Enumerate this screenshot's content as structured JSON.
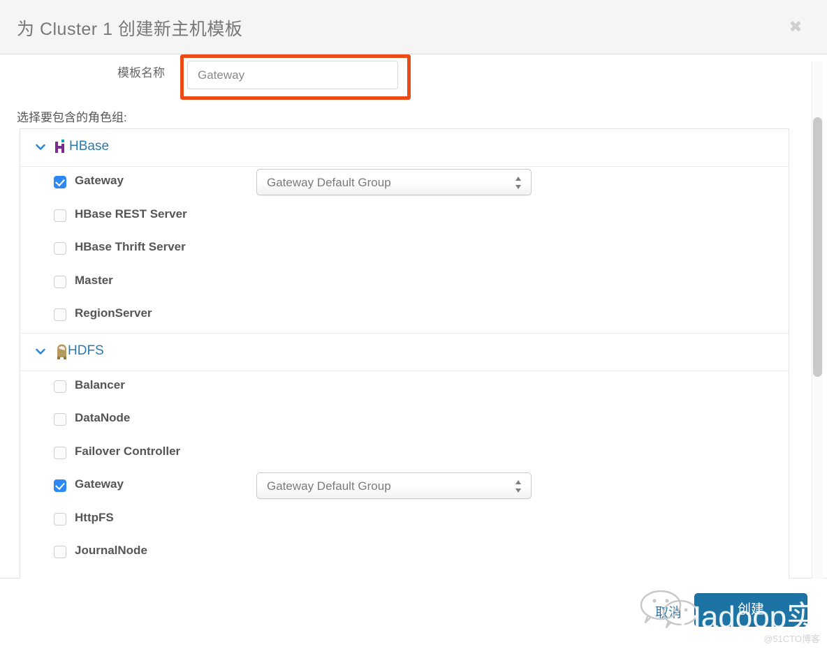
{
  "dialog": {
    "title": "为 Cluster 1 创建新主机模板",
    "close_icon": "close-icon"
  },
  "form": {
    "name_label": "模板名称",
    "name_value": "Gateway",
    "name_placeholder": "Gateway",
    "highlight_color": "#ea4b17"
  },
  "section": {
    "label": "选择要包含的角色组:"
  },
  "services": [
    {
      "name": "HBase",
      "icon": "hbase-logo-icon",
      "expanded": true,
      "chevron_icon": "chevron-down-icon",
      "roles": [
        {
          "label": "Gateway",
          "checked": true,
          "group": "Gateway Default Group"
        },
        {
          "label": "HBase REST Server",
          "checked": false,
          "group": null
        },
        {
          "label": "HBase Thrift Server",
          "checked": false,
          "group": null
        },
        {
          "label": "Master",
          "checked": false,
          "group": null
        },
        {
          "label": "RegionServer",
          "checked": false,
          "group": null
        }
      ]
    },
    {
      "name": "HDFS",
      "icon": "hadoop-elephant-icon",
      "expanded": true,
      "chevron_icon": "chevron-down-icon",
      "roles": [
        {
          "label": "Balancer",
          "checked": false,
          "group": null
        },
        {
          "label": "DataNode",
          "checked": false,
          "group": null
        },
        {
          "label": "Failover Controller",
          "checked": false,
          "group": null
        },
        {
          "label": "Gateway",
          "checked": true,
          "group": "Gateway Default Group"
        },
        {
          "label": "HttpFS",
          "checked": false,
          "group": null
        },
        {
          "label": "JournalNode",
          "checked": false,
          "group": null
        }
      ]
    }
  ],
  "footer": {
    "cancel_label": "取消",
    "create_label": "创建",
    "create_color": "#1c73a4"
  },
  "watermark": {
    "text": "Hadoop实操",
    "logo_icon": "wechat-logo-icon",
    "corner": "@51CTO博客"
  },
  "colors": {
    "header_bg": "#f5f5f5",
    "link_blue": "#2a7ab0",
    "checkbox_blue": "#2b88f5",
    "annotation_orange": "#ea4b17"
  }
}
